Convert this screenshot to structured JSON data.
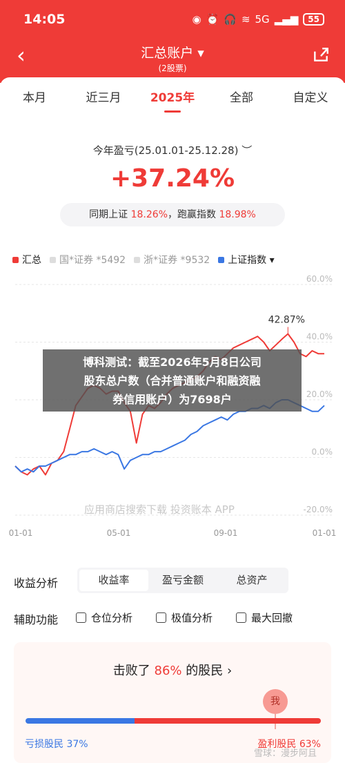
{
  "status": {
    "time": "14:05",
    "network": "5G",
    "battery": "55"
  },
  "nav": {
    "title": "汇总账户 ▾",
    "subtitle": "(2股票)"
  },
  "tabs": [
    "本月",
    "近三月",
    "2025年",
    "全部",
    "自定义"
  ],
  "summary": {
    "label": "今年盈亏(25.01.01-25.12.28)",
    "value": "+37.24%",
    "compare_prefix": "同期上证",
    "compare_sh": "18.26%",
    "compare_mid": "，跑赢指数",
    "compare_beat": "18.98%"
  },
  "legend": [
    {
      "label": "汇总",
      "color": "#ef3b37",
      "active": true
    },
    {
      "label": "国*证券 *5492",
      "color": "#dddddd",
      "active": false
    },
    {
      "label": "浙*证券 *9532",
      "color": "#dddddd",
      "active": false
    },
    {
      "label": "上证指数 ▾",
      "color": "#3a77e3",
      "active": true
    }
  ],
  "chart_data": {
    "type": "line",
    "x_tick_labels": [
      "01-01",
      "05-01",
      "09-01",
      "01-01"
    ],
    "y_tick_labels": [
      "60.0%",
      "40.0%",
      "20.0%",
      "0.0%",
      "-20.0%"
    ],
    "ylim": [
      -20,
      60
    ],
    "annotation": "42.87%",
    "series": [
      {
        "name": "汇总",
        "color": "#ef3b37",
        "values": [
          -3,
          -5,
          -6,
          -4,
          -3,
          -6,
          -2,
          -1,
          2,
          10,
          18,
          21,
          24,
          25,
          24,
          22,
          23,
          23,
          19,
          16,
          5,
          15,
          18,
          17,
          19,
          22,
          24,
          25,
          26,
          27,
          28,
          30,
          33,
          35,
          34,
          36,
          38,
          39,
          40,
          41,
          42,
          40,
          37,
          39,
          41,
          42.87,
          40,
          36,
          35,
          37,
          36,
          36
        ]
      },
      {
        "name": "上证指数",
        "color": "#3a77e3",
        "values": [
          -3,
          -5,
          -4,
          -5,
          -3,
          -3,
          -2,
          -1,
          0,
          1,
          1,
          2,
          2,
          3,
          2,
          1,
          2,
          1,
          -4,
          -1,
          0,
          1,
          1,
          2,
          2,
          3,
          4,
          5,
          6,
          8,
          9,
          11,
          12,
          13,
          14,
          13,
          15,
          16,
          16,
          17,
          17,
          18,
          17,
          19,
          20,
          20,
          19,
          18,
          17,
          16,
          16,
          18
        ]
      }
    ]
  },
  "watermark": "应用商店搜索下载 投资账本 APP",
  "overlay": {
    "line1": "博科测试：截至2026年5月8日公司",
    "line2": "股东总户数（合并普通账户和融资融",
    "line3": "券信用账户）为7698户"
  },
  "analysis": {
    "label": "收益分析",
    "options": [
      "收益率",
      "盈亏金额",
      "总资产"
    ],
    "selected": "收益率"
  },
  "aux": {
    "label": "辅助功能",
    "options": [
      "仓位分析",
      "极值分析",
      "最大回撤"
    ]
  },
  "beat": {
    "prefix": "击败了 ",
    "pct": "86%",
    "suffix": " 的股民 ›",
    "me": "我",
    "loss": "亏损股民 37%",
    "gain": "盈利股民 63%",
    "loss_ratio": 0.37
  },
  "bottom_watermark": "雪球：漫步阿且"
}
